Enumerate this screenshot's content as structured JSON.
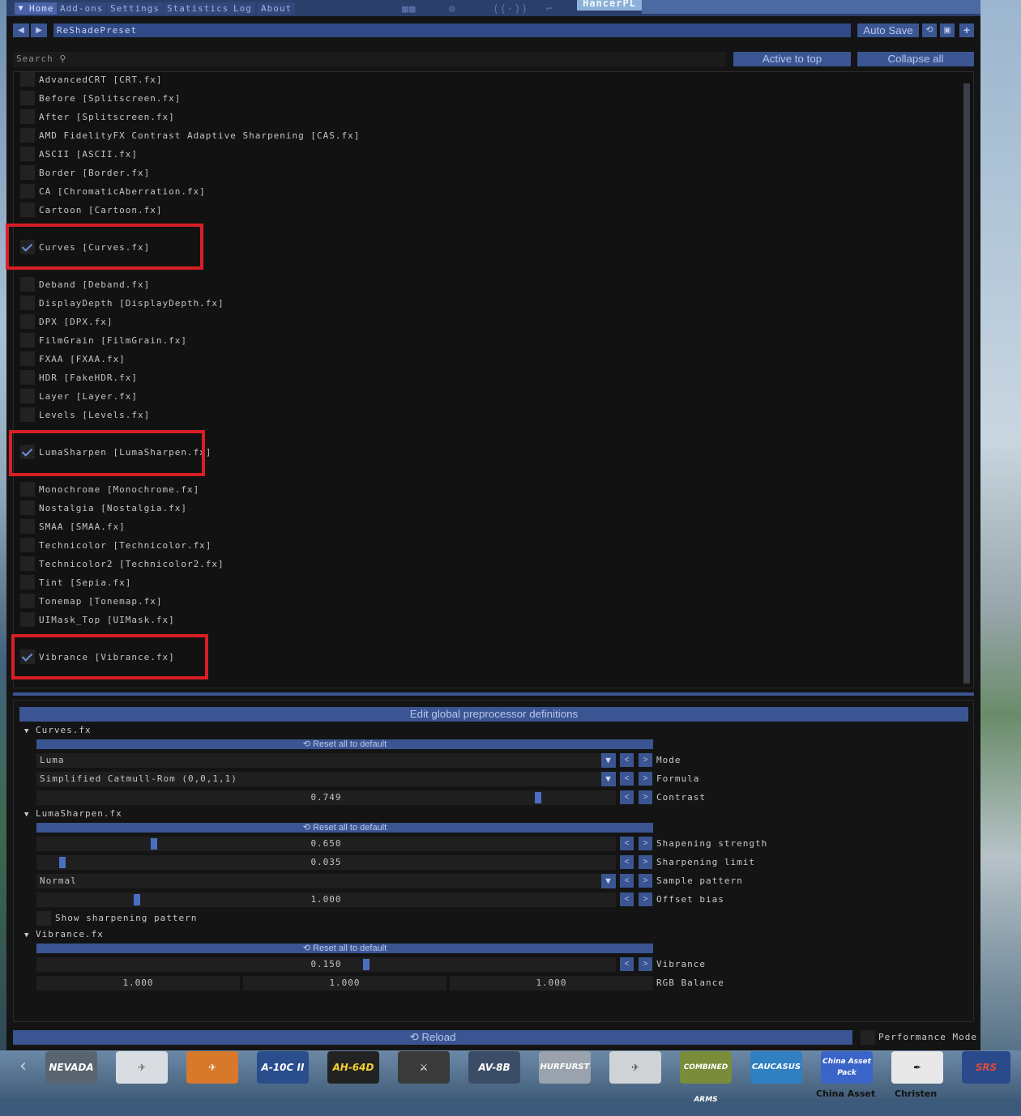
{
  "app": {
    "name": "HancerPL"
  },
  "menu": {
    "items": [
      "Home",
      "Add-ons",
      "Settings",
      "Statistics",
      "Log",
      "About"
    ]
  },
  "preset": {
    "name": "ReShadePreset",
    "auto_save": "Auto Save"
  },
  "toolbar": {
    "search_label": "Search",
    "active_to_top": "Active to top",
    "collapse_all": "Collapse all"
  },
  "effects": [
    "AdvancedCRT [CRT.fx]",
    "Before [Splitscreen.fx]",
    "After [Splitscreen.fx]",
    "AMD FidelityFX Contrast Adaptive Sharpening [CAS.fx]",
    "ASCII [ASCII.fx]",
    "Border [Border.fx]",
    "CA [ChromaticAberration.fx]",
    "Cartoon [Cartoon.fx]",
    "Curves [Curves.fx]",
    "Deband [Deband.fx]",
    "DisplayDepth [DisplayDepth.fx]",
    "DPX [DPX.fx]",
    "FilmGrain [FilmGrain.fx]",
    "FXAA [FXAA.fx]",
    "HDR [FakeHDR.fx]",
    "Layer [Layer.fx]",
    "Levels [Levels.fx]",
    "LumaSharpen [LumaSharpen.fx]",
    "Monochrome [Monochrome.fx]",
    "Nostalgia [Nostalgia.fx]",
    "SMAA [SMAA.fx]",
    "Technicolor [Technicolor.fx]",
    "Technicolor2 [Technicolor2.fx]",
    "Tint [Sepia.fx]",
    "Tonemap [Tonemap.fx]",
    "UIMask_Top [UIMask.fx]",
    "Vibrance [Vibrance.fx]"
  ],
  "settings": {
    "edit_defs": "Edit global preprocessor definitions",
    "reset_label": "Reset all to default",
    "curves": {
      "title": "Curves.fx",
      "mode_value": "Luma",
      "mode_label": "Mode",
      "formula_value": "Simplified Catmull-Rom (0,0,1,1)",
      "formula_label": "Formula",
      "contrast_value": "0.749",
      "contrast_label": "Contrast",
      "contrast_level": 0.87
    },
    "lumasharpen": {
      "title": "LumaSharpen.fx",
      "strength_value": "0.650",
      "strength_label": "Shapening strength",
      "strength_level": 0.2,
      "limit_value": "0.035",
      "limit_label": "Sharpening limit",
      "limit_level": 0.04,
      "pattern_value": "Normal",
      "pattern_label": "Sample pattern",
      "offset_value": "1.000",
      "offset_label": "Offset bias",
      "offset_level": 0.17,
      "show_pattern_label": "Show sharpening pattern"
    },
    "vibrance": {
      "title": "Vibrance.fx",
      "vibrance_value": "0.150",
      "vibrance_label": "Vibrance",
      "vibrance_level": 0.57,
      "rgb": [
        "1.000",
        "1.000",
        "1.000"
      ],
      "rgb_label": "RGB Balance"
    }
  },
  "footer": {
    "reload": "Reload",
    "performance_mode": "Performance Mode"
  },
  "taskbar": {
    "tiles": [
      "NEVADA",
      "",
      "",
      "A-10C II",
      "AH-64D",
      "",
      "AV-8B",
      "HURFURST",
      "",
      "COMBINED ARMS",
      "CAUCASUS",
      "China Asset Pack",
      "",
      "SRS"
    ],
    "captions": [
      "China Asset",
      "Christen"
    ]
  },
  "colors": {
    "accent": "#3a5592",
    "highlight_box": "#d91f25",
    "check": "#6d8ed8"
  }
}
